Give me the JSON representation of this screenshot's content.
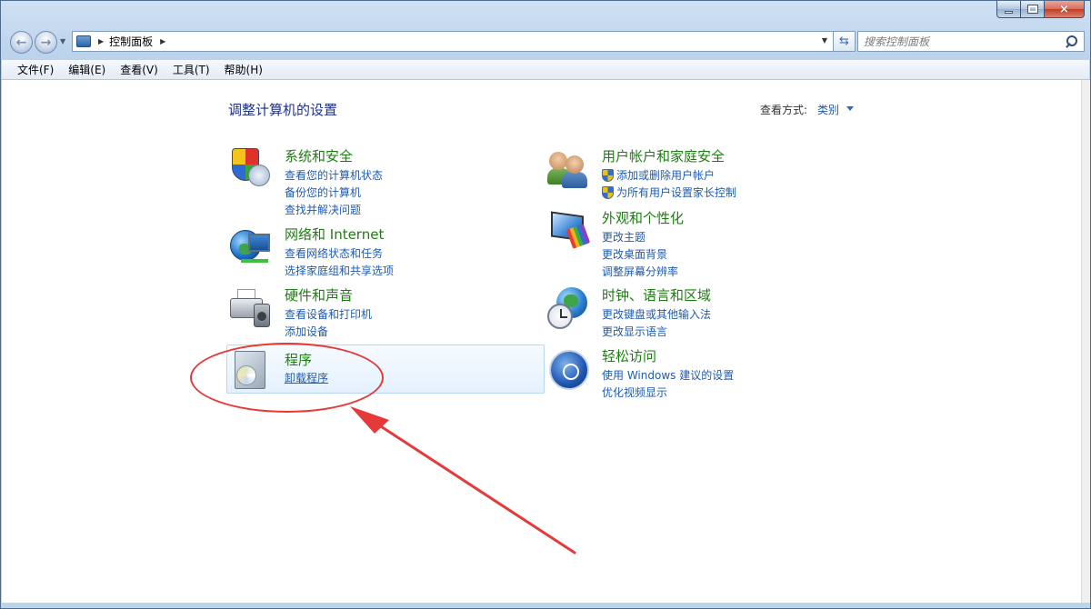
{
  "window": {
    "buttons": {
      "minimize": "minimize",
      "maximize": "maximize",
      "close": "×"
    }
  },
  "address": {
    "breadcrumb": "控制面板"
  },
  "search": {
    "placeholder": "搜索控制面板"
  },
  "menu": [
    "文件(F)",
    "编辑(E)",
    "查看(V)",
    "工具(T)",
    "帮助(H)"
  ],
  "page": {
    "title": "调整计算机的设置",
    "view_label": "查看方式:",
    "view_value": "类别"
  },
  "categories": [
    {
      "title": "系统和安全",
      "icon": "shield-icon",
      "links": [
        "查看您的计算机状态",
        "备份您的计算机",
        "查找并解决问题"
      ]
    },
    {
      "title": "网络和 Internet",
      "icon": "network-globe-icon",
      "links": [
        "查看网络状态和任务",
        "选择家庭组和共享选项"
      ]
    },
    {
      "title": "硬件和声音",
      "icon": "printer-speaker-icon",
      "links": [
        "查看设备和打印机",
        "添加设备"
      ]
    },
    {
      "title": "程序",
      "icon": "programs-icon",
      "links": [
        "卸载程序"
      ]
    },
    {
      "title": "用户帐户和家庭安全",
      "icon": "users-icon",
      "links": [
        "添加或删除用户帐户",
        "为所有用户设置家长控制"
      ]
    },
    {
      "title": "外观和个性化",
      "icon": "monitor-palette-icon",
      "links": [
        "更改主题",
        "更改桌面背景",
        "调整屏幕分辨率"
      ]
    },
    {
      "title": "时钟、语言和区域",
      "icon": "clock-globe-icon",
      "links": [
        "更改键盘或其他输入法",
        "更改显示语言"
      ]
    },
    {
      "title": "轻松访问",
      "icon": "ease-of-access-icon",
      "links": [
        "使用 Windows 建议的设置",
        "优化视频显示"
      ]
    }
  ],
  "colors": {
    "title_blue": "#1e3287",
    "category_green": "#1e7d12",
    "link_blue": "#1f5bb0",
    "annotation_red": "#e53a3a"
  }
}
